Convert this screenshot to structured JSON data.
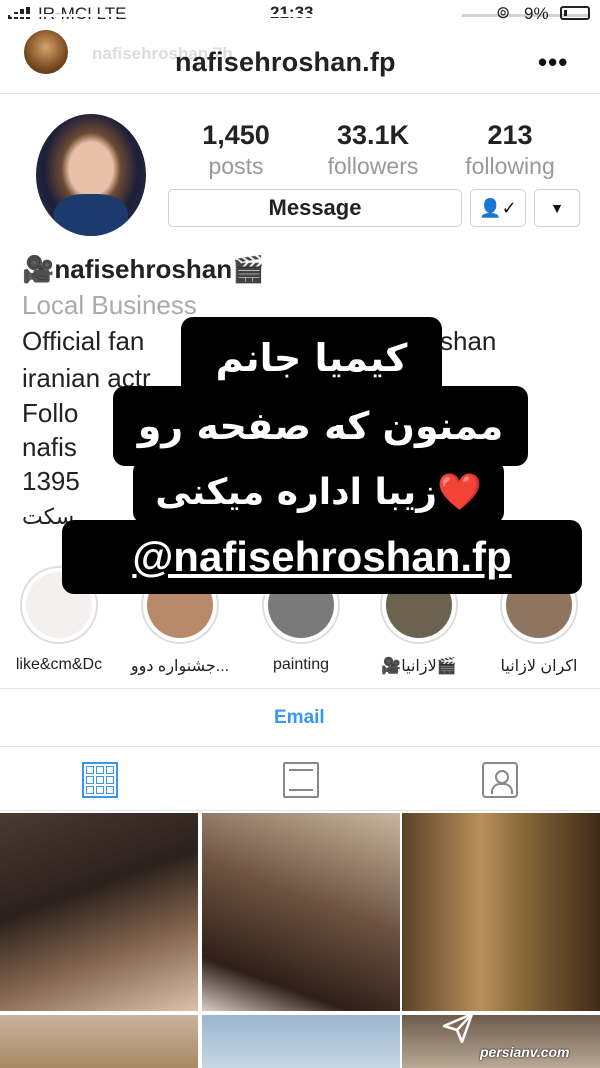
{
  "status_bar": {
    "carrier": "IR-MCI LTE",
    "time": "21:33",
    "battery": "9%",
    "story_progress": 0.78
  },
  "story": {
    "owner_name": "nafisehroshan 7h"
  },
  "header": {
    "title": "nafisehroshan.fp",
    "more": "•••"
  },
  "profile": {
    "stats": [
      {
        "value": "1,450",
        "label": "posts"
      },
      {
        "value": "33.1K",
        "label": "followers"
      },
      {
        "value": "213",
        "label": "following"
      }
    ],
    "message_button": "Message",
    "following_icon": "👤✓",
    "dropdown_icon": "▼",
    "name": "🎥nafisehroshan🎬",
    "category": "Local Business",
    "bio_lines": [
      "Official fan",
      "iranian actr",
      "Follo",
      "nafis",
      "1395",
      "سکت"
    ],
    "bio_tails": [
      "shan"
    ]
  },
  "story_overlay": {
    "line1": "کیمیا جانم",
    "line2": "ممنون که صفحه رو",
    "line3": "زیبا اداره میکنی❤️",
    "line4": "@nafisehroshan.fp"
  },
  "highlights": [
    {
      "label": "like&cm&Dc",
      "color": "#f4f0f0"
    },
    {
      "label": "جشنواره دوو...",
      "color": "#b98a6a"
    },
    {
      "label": "painting",
      "color": "#7a7a7a"
    },
    {
      "label": "🎥لازانیا🎬",
      "color": "#6b6250"
    },
    {
      "label": "اکران لازانیا",
      "color": "#8f7460"
    }
  ],
  "email_label": "Email",
  "tabs": {
    "grid": "grid-icon",
    "feed": "feed-icon",
    "tagged": "tagged-icon"
  },
  "watermark": "persianv.com"
}
